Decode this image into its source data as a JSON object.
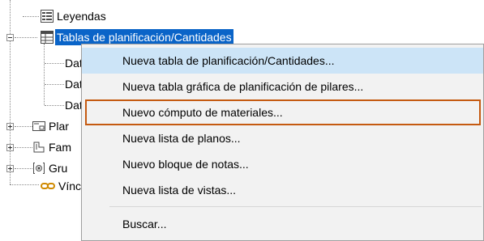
{
  "tree": {
    "items": [
      {
        "label": "Leyendas",
        "icon": "legend-icon"
      },
      {
        "label": "Tablas de planificación/Cantidades",
        "icon": "schedule-table-icon",
        "selected": true
      },
      {
        "label": "Dat",
        "icon": "none"
      },
      {
        "label": "Dat",
        "icon": "none"
      },
      {
        "label": "Dat",
        "icon": "none"
      },
      {
        "label": "Plar",
        "icon": "sheet-icon"
      },
      {
        "label": "Fam",
        "icon": "family-icon"
      },
      {
        "label": "Gru",
        "icon": "group-icon"
      },
      {
        "label": "Vínc",
        "icon": "link-icon"
      }
    ]
  },
  "context_menu": {
    "items": [
      {
        "label": "Nueva tabla de planificación/Cantidades..."
      },
      {
        "label": "Nueva tabla gráfica de planificación de pilares..."
      },
      {
        "label": "Nuevo cómputo de materiales..."
      },
      {
        "label": "Nueva lista de planos..."
      },
      {
        "label": "Nuevo bloque de notas..."
      },
      {
        "label": "Nueva lista de vistas..."
      },
      {
        "label": "Buscar..."
      }
    ],
    "hover_color": "#cce4f7",
    "highlight_border_color": "#c55a11",
    "selection_color": "#0a64c8"
  }
}
